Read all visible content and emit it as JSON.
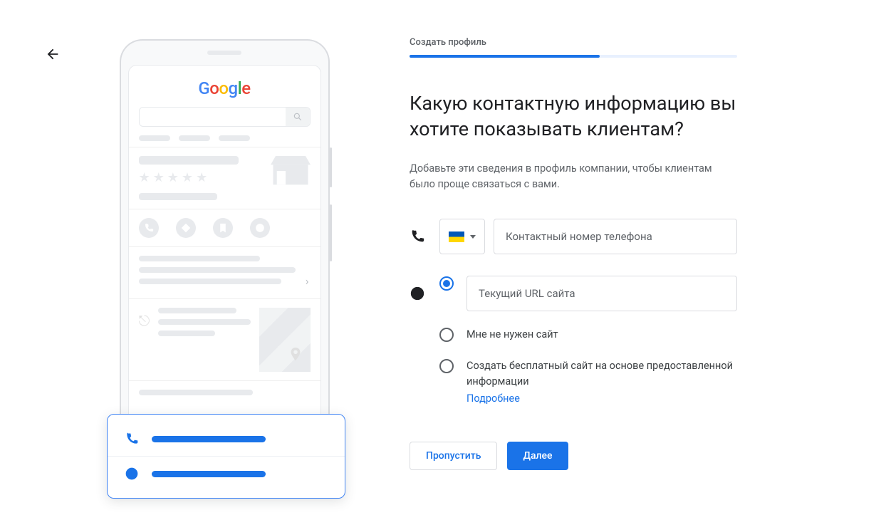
{
  "google_logo_letters": [
    "G",
    "o",
    "o",
    "g",
    "l",
    "e"
  ],
  "stepper": {
    "label": "Создать профиль",
    "progress_pct": 58
  },
  "heading": "Какую контактную информацию вы хотите показывать клиентам?",
  "subtext": "Добавьте эти сведения в профиль компании, чтобы клиентам было проще связаться с вами.",
  "phone_field": {
    "country_code": "UA",
    "placeholder": "Контактный номер телефона",
    "value": ""
  },
  "website": {
    "options": [
      {
        "id": "url",
        "label": "Текущий URL сайта",
        "input": true
      },
      {
        "id": "none",
        "label": "Мне не нужен сайт"
      },
      {
        "id": "free",
        "label": "Создать бесплатный сайт на основе предоставленной информации",
        "learn_more": "Подробнее"
      }
    ],
    "selected": "url",
    "url_value": ""
  },
  "buttons": {
    "skip": "Пропустить",
    "next": "Далее"
  }
}
